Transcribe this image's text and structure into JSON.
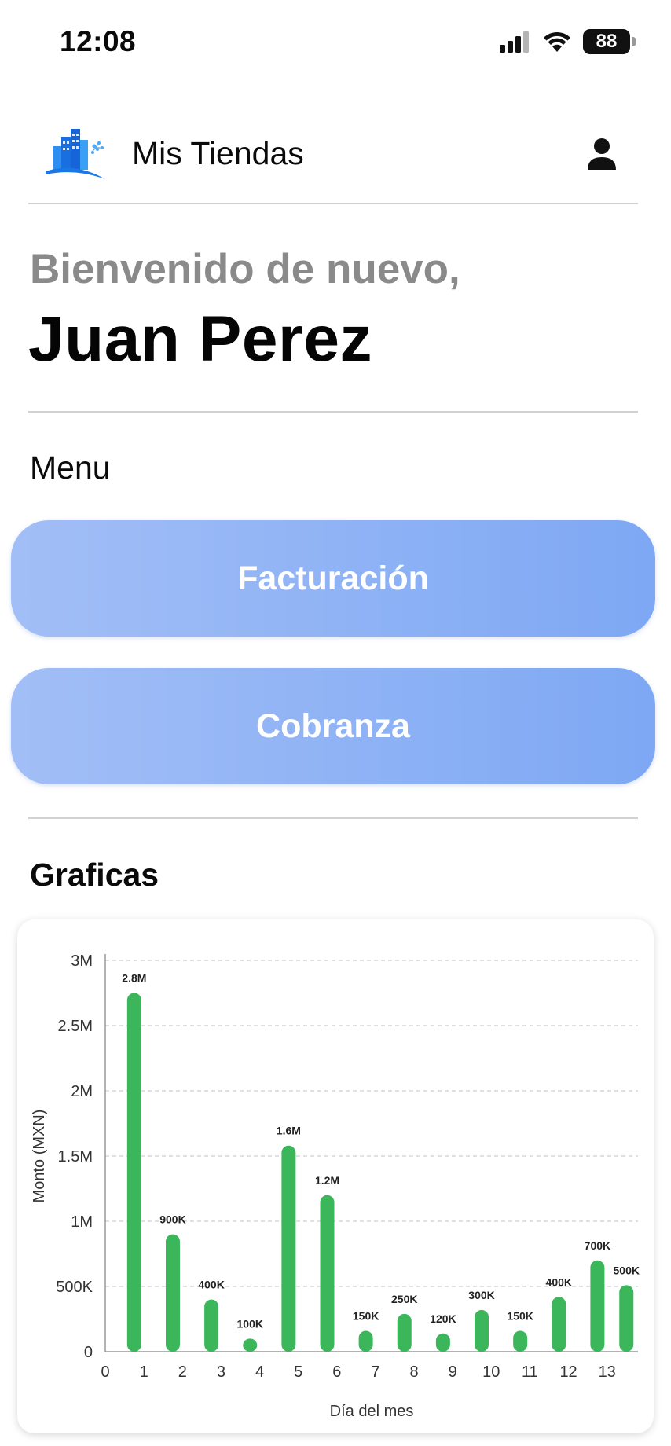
{
  "status_bar": {
    "time": "12:08",
    "battery": "88"
  },
  "header": {
    "app_title": "Mis Tiendas",
    "logo_icon": "buildings-logo-icon",
    "profile_icon": "person-icon"
  },
  "welcome": {
    "greeting": "Bienvenido de nuevo,",
    "name": "Juan Perez"
  },
  "menu": {
    "label": "Menu",
    "items": [
      {
        "label": "Facturación"
      },
      {
        "label": "Cobranza"
      }
    ],
    "button_color_start": "#a2bef6",
    "button_color_end": "#7ea8f4"
  },
  "graphs": {
    "label": "Graficas"
  },
  "chart_data": {
    "type": "bar",
    "xlabel": "Día del mes",
    "ylabel": "Monto (MXN)",
    "x_ticks": [
      "0",
      "1",
      "2",
      "3",
      "4",
      "5",
      "6",
      "7",
      "8",
      "9",
      "10",
      "11",
      "12",
      "13"
    ],
    "y_ticks": [
      "0",
      "500K",
      "1M",
      "1.5M",
      "2M",
      "2.5M",
      "3M"
    ],
    "ylim": [
      0,
      3000000
    ],
    "xlim": [
      0,
      13.8
    ],
    "x": [
      0.75,
      1.75,
      2.75,
      3.75,
      4.75,
      5.75,
      6.75,
      7.75,
      8.75,
      9.75,
      10.75,
      11.75,
      12.75,
      13.5
    ],
    "values": [
      2750000,
      900000,
      400000,
      100000,
      1580000,
      1200000,
      160000,
      290000,
      140000,
      320000,
      160000,
      420000,
      700000,
      510000
    ],
    "data_labels": [
      "2.8M",
      "900K",
      "400K",
      "100K",
      "1.6M",
      "1.2M",
      "150K",
      "250K",
      "120K",
      "300K",
      "150K",
      "400K",
      "700K",
      "500K"
    ],
    "bar_color": "#3cb65a",
    "grid": "horizontal dashed",
    "legend": "none"
  }
}
